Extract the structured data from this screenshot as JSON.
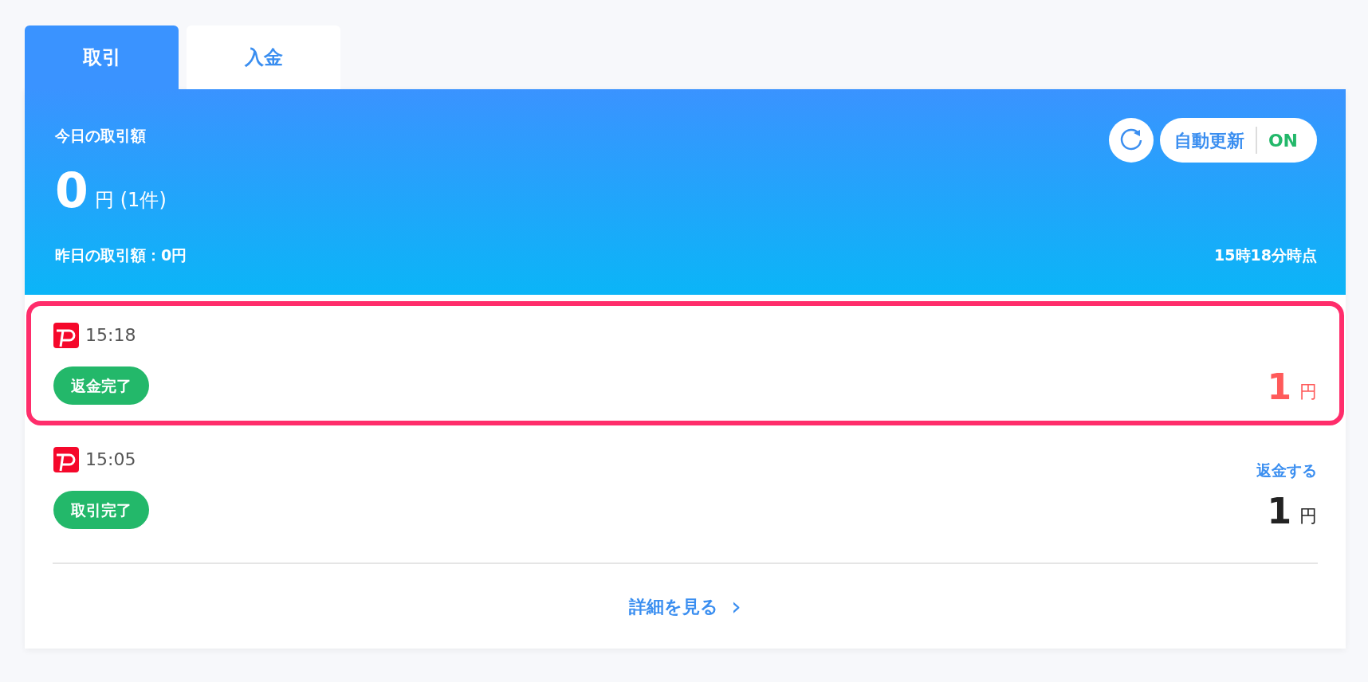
{
  "tabs": [
    {
      "label": "取引",
      "selected": true
    },
    {
      "label": "入金",
      "selected": false
    }
  ],
  "summary": {
    "title": "今日の取引額",
    "amount": "0",
    "unit": "円",
    "count": "(1件)",
    "yesterday": "昨日の取引額：0円",
    "as_of": "15時18分時点",
    "auto_update": {
      "label": "自動更新",
      "state_label": "ON",
      "on": true
    }
  },
  "transactions": [
    {
      "time": "15:18",
      "status": "返金完了",
      "amount": "1",
      "unit": "円",
      "color": "#ff5a5a",
      "highlighted": true
    },
    {
      "time": "15:05",
      "status": "取引完了",
      "amount": "1",
      "unit": "円",
      "color": "#222222",
      "highlighted": false,
      "action": "返金する"
    }
  ],
  "more_link": {
    "label": "詳細を見る",
    "icon": "›"
  }
}
